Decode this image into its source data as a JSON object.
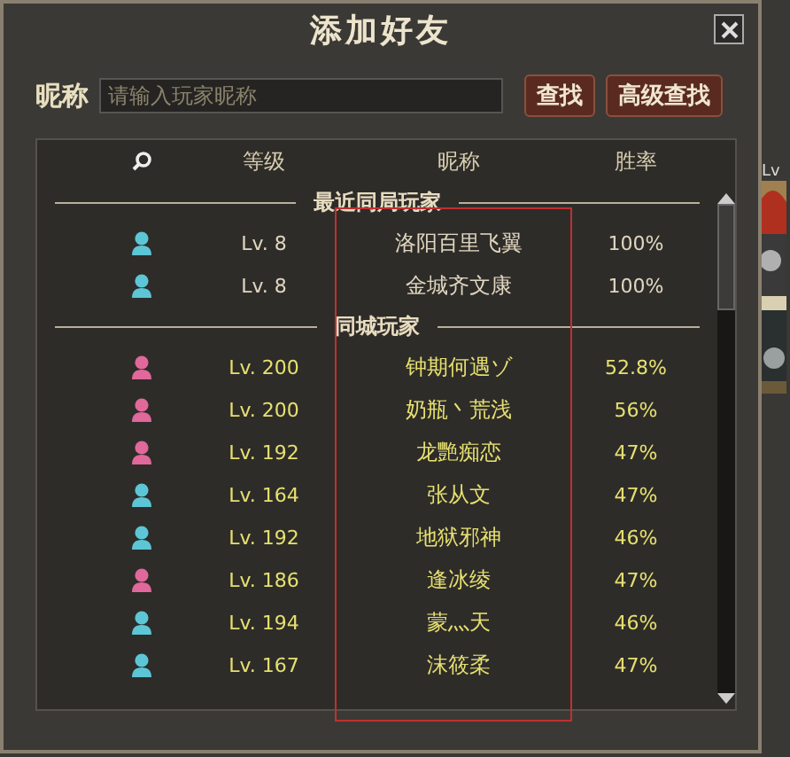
{
  "window": {
    "title": "添加好友"
  },
  "search": {
    "label": "昵称",
    "placeholder": "请输入玩家昵称"
  },
  "buttons": [
    "查找",
    "高级查找"
  ],
  "columns": [
    "等级",
    "昵称",
    "胜率"
  ],
  "sections": [
    {
      "title": "最近同局玩家",
      "kind": "recent",
      "rows": [
        {
          "color": "#5cc6d6",
          "level": "Lv. 8",
          "name": "洛阳百里飞翼",
          "rate": "100%"
        },
        {
          "color": "#5cc6d6",
          "level": "Lv. 8",
          "name": "金城齐文康",
          "rate": "100%"
        }
      ]
    },
    {
      "title": "同城玩家",
      "kind": "city",
      "rows": [
        {
          "color": "#e0689a",
          "level": "Lv. 200",
          "name": "钟期何遇ゾ",
          "rate": "52.8%"
        },
        {
          "color": "#e0689a",
          "level": "Lv. 200",
          "name": "奶瓶丶荒浅",
          "rate": "56%"
        },
        {
          "color": "#e0689a",
          "level": "Lv. 192",
          "name": "龙艷痴恋",
          "rate": "47%"
        },
        {
          "color": "#5cc6d6",
          "level": "Lv. 164",
          "name": "张从文",
          "rate": "47%"
        },
        {
          "color": "#5cc6d6",
          "level": "Lv. 192",
          "name": "地狱邪神",
          "rate": "46%"
        },
        {
          "color": "#e0689a",
          "level": "Lv. 186",
          "name": "逢冰绫",
          "rate": "47%"
        },
        {
          "color": "#5cc6d6",
          "level": "Lv. 194",
          "name": "蒙灬天",
          "rate": "46%"
        },
        {
          "color": "#5cc6d6",
          "level": "Lv. 167",
          "name": "沫筱柔",
          "rate": "47%"
        }
      ]
    }
  ],
  "background_label": "Lv"
}
